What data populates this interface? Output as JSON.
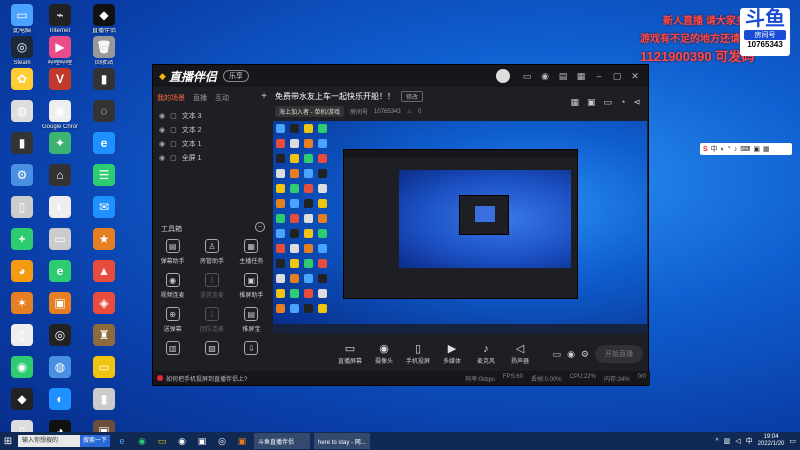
{
  "desktop": {
    "icons": [
      {
        "label": "此电脑",
        "color": "#4aa3ff",
        "glyph": "▭"
      },
      {
        "label": "Internet",
        "color": "#222",
        "glyph": "⌁"
      },
      {
        "label": "直播伴侣",
        "color": "#111",
        "glyph": "◆"
      },
      {
        "label": "Steam",
        "color": "#1b2838",
        "glyph": "◎"
      },
      {
        "label": "哔哩哔哩",
        "color": "#ea4c89",
        "glyph": "▶"
      },
      {
        "label": "回收站",
        "color": "#999",
        "glyph": "🗑"
      },
      {
        "label": "",
        "color": "#ffcc33",
        "glyph": "✿"
      },
      {
        "label": "",
        "color": "#c0392b",
        "glyph": "V"
      },
      {
        "label": "",
        "color": "#333",
        "glyph": "▮"
      },
      {
        "label": "",
        "color": "#ddd",
        "glyph": "◍"
      },
      {
        "label": "Google Chrome",
        "color": "#eee",
        "glyph": "◉"
      },
      {
        "label": "",
        "color": "#333",
        "glyph": "◌"
      },
      {
        "label": "",
        "color": "#333",
        "glyph": "▮"
      },
      {
        "label": "",
        "color": "#3cb371",
        "glyph": "✦"
      },
      {
        "label": "",
        "color": "#1e90ff",
        "glyph": "e"
      },
      {
        "label": "",
        "color": "#4a90e2",
        "glyph": "⚙"
      },
      {
        "label": "",
        "color": "#333",
        "glyph": "⌂"
      },
      {
        "label": "",
        "color": "#2ecc71",
        "glyph": "☰"
      },
      {
        "label": "",
        "color": "#ccc",
        "glyph": "▯"
      },
      {
        "label": "",
        "color": "#eee",
        "glyph": "◐"
      },
      {
        "label": "",
        "color": "#1e90ff",
        "glyph": "✉"
      },
      {
        "label": "",
        "color": "#2ecc71",
        "glyph": "+"
      },
      {
        "label": "",
        "color": "#ccc",
        "glyph": "▭"
      },
      {
        "label": "",
        "color": "#e67e22",
        "glyph": "★"
      },
      {
        "label": "",
        "color": "#f39c12",
        "glyph": "◕"
      },
      {
        "label": "",
        "color": "#2ecc71",
        "glyph": "e"
      },
      {
        "label": "",
        "color": "#e74c3c",
        "glyph": "▲"
      },
      {
        "label": "",
        "color": "#e67e22",
        "glyph": "✶"
      },
      {
        "label": "",
        "color": "#e67e22",
        "glyph": "▣"
      },
      {
        "label": "",
        "color": "#e74c3c",
        "glyph": "◈"
      },
      {
        "label": "",
        "color": "#eee",
        "glyph": "▯"
      },
      {
        "label": "",
        "color": "#222",
        "glyph": "◎"
      },
      {
        "label": "",
        "color": "#8e6a3d",
        "glyph": "♜"
      },
      {
        "label": "",
        "color": "#2ecc71",
        "glyph": "◉"
      },
      {
        "label": "",
        "color": "#4a90e2",
        "glyph": "◍"
      },
      {
        "label": "",
        "color": "#f1c40f",
        "glyph": "▭"
      },
      {
        "label": "",
        "color": "#222",
        "glyph": "◆"
      },
      {
        "label": "",
        "color": "#1e90ff",
        "glyph": "◐"
      },
      {
        "label": "",
        "color": "#ccc",
        "glyph": "▮"
      },
      {
        "label": "",
        "color": "#ddd",
        "glyph": "▯"
      },
      {
        "label": "",
        "color": "#111",
        "glyph": "◕"
      },
      {
        "label": "",
        "color": "#6b4f3a",
        "glyph": "▣"
      }
    ]
  },
  "overlay": {
    "line1": "新人直播 请大家多多关照",
    "line2": "游戏有不足的地方还请见谅",
    "line3": "1121900390 可发码",
    "badge_big": "斗鱼",
    "badge_sub": "房间号",
    "badge_num": "10765343"
  },
  "app": {
    "logo": "直播伴侣",
    "badge": "乐享",
    "sidebar": {
      "tabs": [
        "我的场景",
        "直播",
        "互动"
      ],
      "scenes": [
        "文本 3",
        "文本 2",
        "文本 1",
        "全屏 1"
      ],
      "toolbox_title": "工具箱",
      "tools": [
        {
          "label": "弹幕助手",
          "icon": "▤",
          "dim": false
        },
        {
          "label": "房管助手",
          "icon": "♙",
          "dim": false
        },
        {
          "label": "主播任务",
          "icon": "▦",
          "dim": false
        },
        {
          "label": "视频连麦",
          "icon": "◉",
          "dim": false
        },
        {
          "label": "语音连麦",
          "icon": "⇩",
          "dim": true
        },
        {
          "label": "推屏助手",
          "icon": "▣",
          "dim": false
        },
        {
          "label": "送弹幕",
          "icon": "⊕",
          "dim": false
        },
        {
          "label": "团队连麦",
          "icon": "⇩",
          "dim": true
        },
        {
          "label": "推屏宝",
          "icon": "▤",
          "dim": false
        },
        {
          "label": "",
          "icon": "▥",
          "dim": false
        },
        {
          "label": "",
          "icon": "▧",
          "dim": false
        },
        {
          "label": "",
          "icon": "⇩",
          "dim": false
        }
      ]
    },
    "live": {
      "title": "免费带水友上车一起快乐开船！！",
      "edit": "修改",
      "category": "海上加入者 - 单机/游戏",
      "room_label": "房间号",
      "room": "10765343",
      "hot": "0"
    },
    "bottom": [
      {
        "label": "直播屏幕",
        "icon": "▭"
      },
      {
        "label": "摄像头",
        "icon": "◉"
      },
      {
        "label": "手机投屏",
        "icon": "▯"
      },
      {
        "label": "多媒体",
        "icon": "▶"
      },
      {
        "label": "麦克风",
        "icon": "♪"
      },
      {
        "label": "扬声器",
        "icon": "◁"
      }
    ],
    "start_label": "开始直播",
    "status": {
      "hint": "如何把手机投屏到直播伴侣上?",
      "stats": [
        "码率:0kbps",
        "FPS:60",
        "丢帧:0.00%",
        "CPU:22%",
        "内存:34%",
        "0/0"
      ]
    }
  },
  "taskbar": {
    "search_placeholder": "输入你想搜的",
    "search_btn": "搜索一下",
    "tasks": [
      "斗鱼直播伴侣",
      "here to stay - 网..."
    ],
    "time": "19:04",
    "date": "2022/1/20"
  }
}
